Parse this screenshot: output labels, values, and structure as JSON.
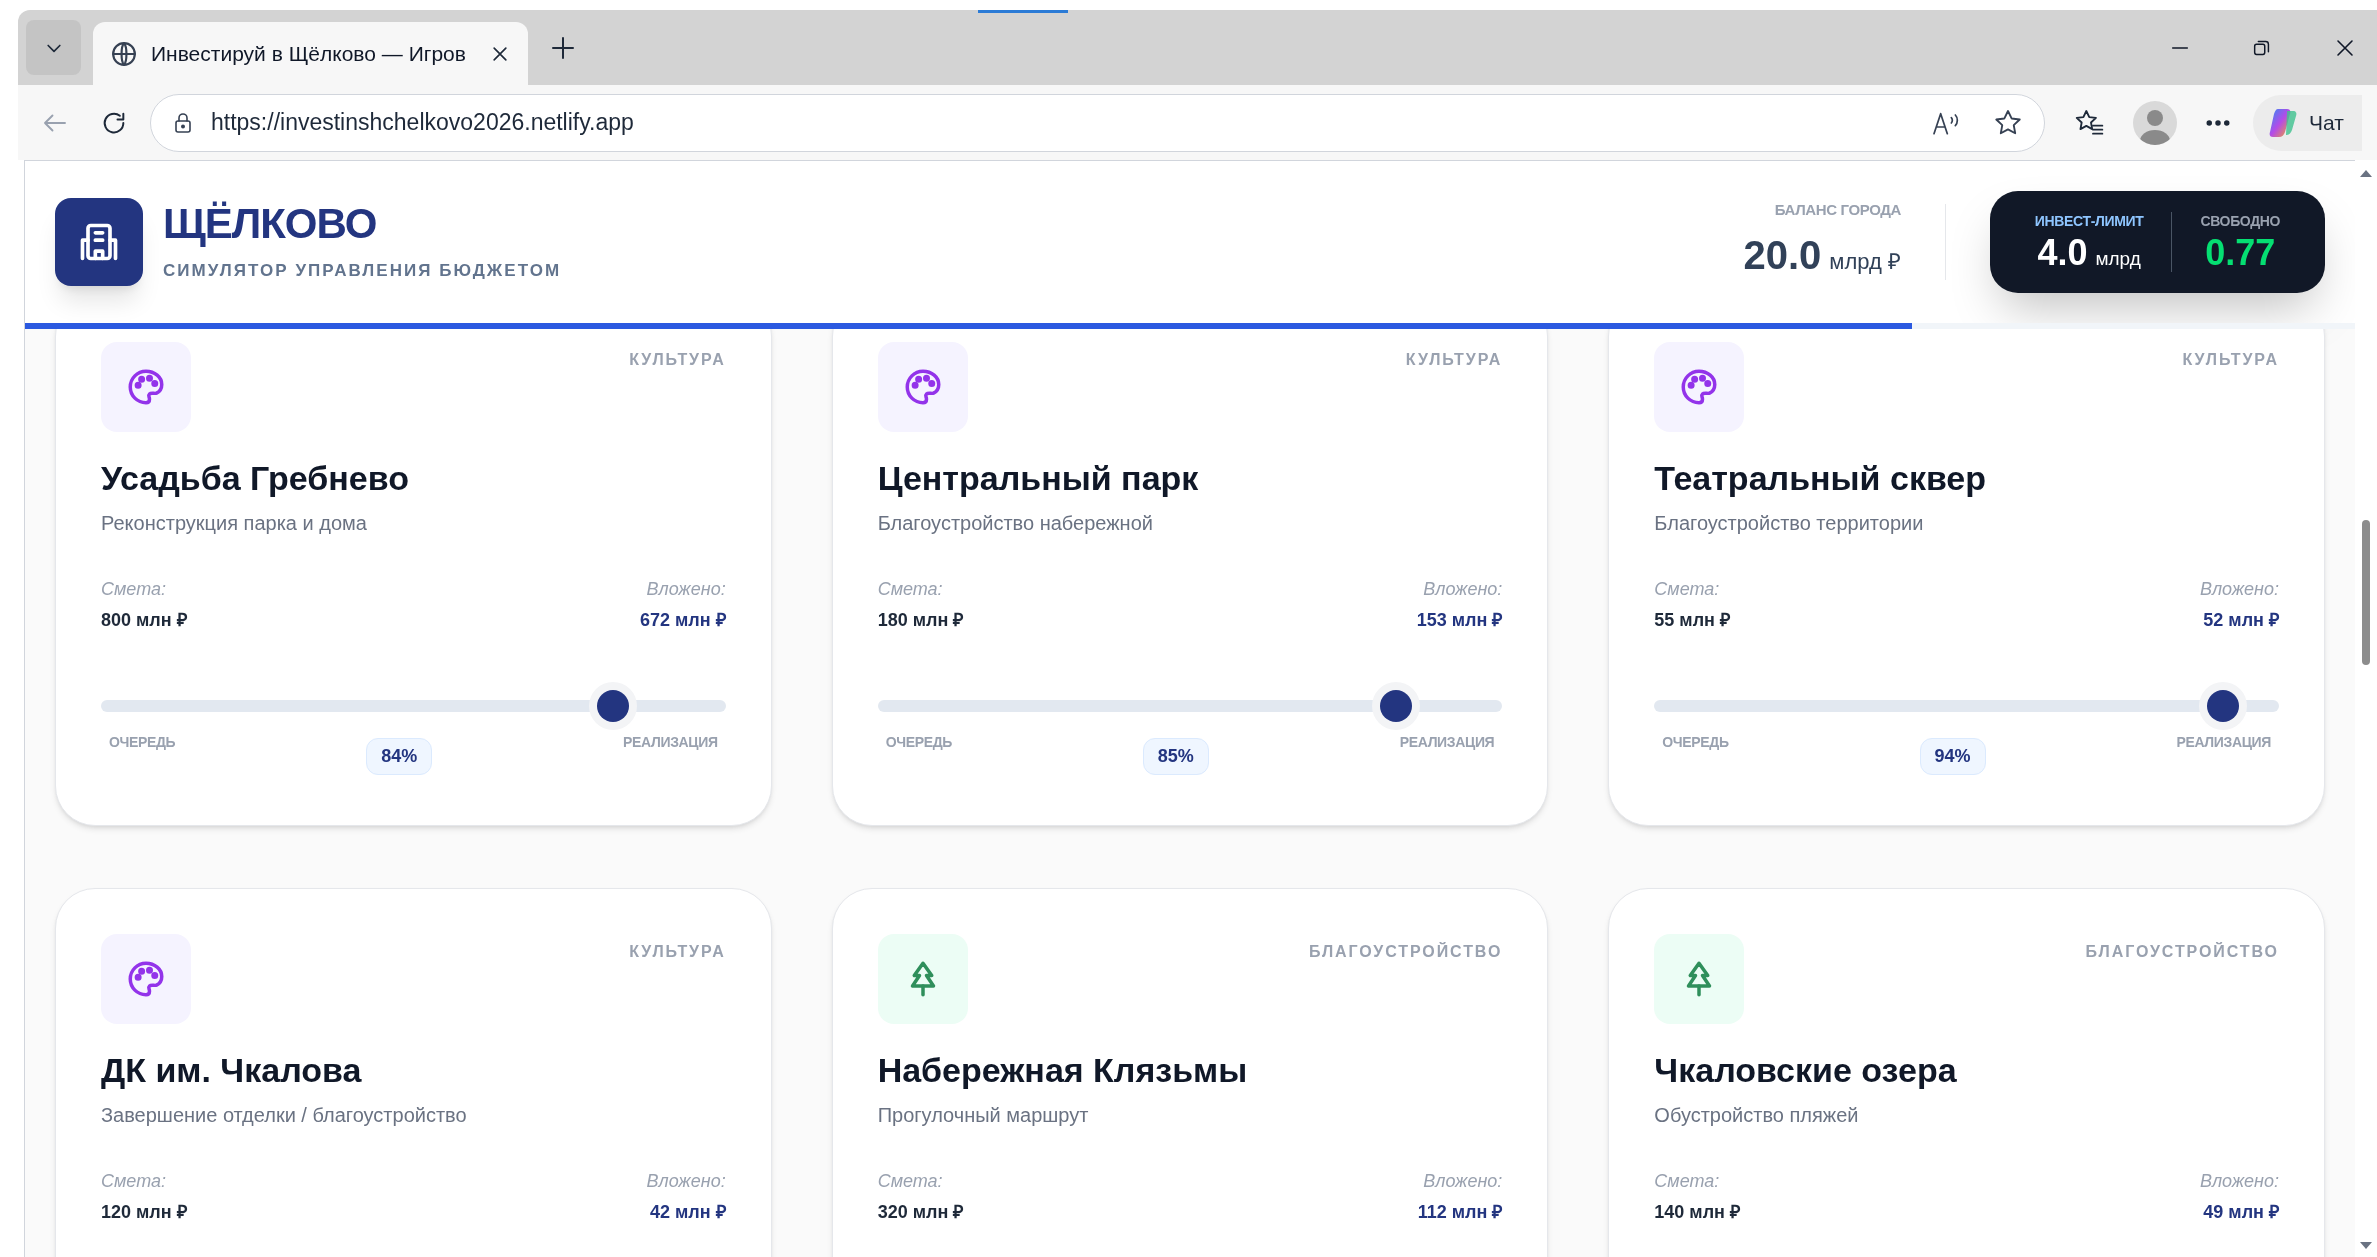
{
  "browser": {
    "tab": {
      "title": "Инвестируй в Щёлково — Игров",
      "selected": true
    },
    "url": "https://investinshchelkovo2026.netlify.app",
    "chat_label": "Чат"
  },
  "header": {
    "title": "ЩЁЛКОВО",
    "subtitle": "СИМУЛЯТОР УПРАВЛЕНИЯ БЮДЖЕТОМ",
    "balance": {
      "label": "БАЛАНС ГОРОДА",
      "value": "20.0",
      "unit": "млрд ₽"
    },
    "limit": {
      "label": "ИНВЕСТ-ЛИМИТ",
      "value": "4.0",
      "unit": "млрд"
    },
    "free": {
      "label": "СВОБОДНО",
      "value": "0.77"
    },
    "progress": {
      "level": 0.81
    }
  },
  "projects": [
    {
      "kind": "culture",
      "category": "КУЛЬТУРА",
      "title": "Усадьба Гребнево",
      "subtitle": "Реконструкция парка и дома",
      "estimate_label": "Смета:",
      "estimate": "800 млн ₽",
      "invested_label": "Вложено:",
      "invested": "672 млн ₽",
      "slider": {
        "level": 0.82,
        "left_label": "ОЧЕРЕДЬ",
        "right_label": "РЕАЛИЗАЦИЯ",
        "percent": "84%"
      }
    },
    {
      "kind": "culture",
      "category": "КУЛЬТУРА",
      "title": "Центральный парк",
      "subtitle": "Благоустройство набережной",
      "estimate_label": "Смета:",
      "estimate": "180 млн ₽",
      "invested_label": "Вложено:",
      "invested": "153 млн ₽",
      "slider": {
        "level": 0.83,
        "left_label": "ОЧЕРЕДЬ",
        "right_label": "РЕАЛИЗАЦИЯ",
        "percent": "85%"
      }
    },
    {
      "kind": "culture",
      "category": "КУЛЬТУРА",
      "title": "Театральный сквер",
      "subtitle": "Благоустройство территории",
      "estimate_label": "Смета:",
      "estimate": "55 млн ₽",
      "invested_label": "Вложено:",
      "invested": "52 млн ₽",
      "slider": {
        "level": 0.91,
        "left_label": "ОЧЕРЕДЬ",
        "right_label": "РЕАЛИЗАЦИЯ",
        "percent": "94%"
      }
    },
    {
      "kind": "culture",
      "category": "КУЛЬТУРА",
      "title": "ДК им. Чкалова",
      "subtitle": "Завершение отделки / благоустройство",
      "estimate_label": "Смета:",
      "estimate": "120 млн ₽",
      "invested_label": "Вложено:",
      "invested": "42 млн ₽"
    },
    {
      "kind": "improvement",
      "category": "БЛАГОУСТРОЙСТВО",
      "title": "Набережная Клязьмы",
      "subtitle": "Прогулочный маршрут",
      "estimate_label": "Смета:",
      "estimate": "320 млн ₽",
      "invested_label": "Вложено:",
      "invested": "112 млн ₽"
    },
    {
      "kind": "improvement",
      "category": "БЛАГОУСТРОЙСТВО",
      "title": "Чкаловские озера",
      "subtitle": "Обустройство пляжей",
      "estimate_label": "Смета:",
      "estimate": "140 млн ₽",
      "invested_label": "Вложено:",
      "invested": "49 млн ₽"
    }
  ]
}
